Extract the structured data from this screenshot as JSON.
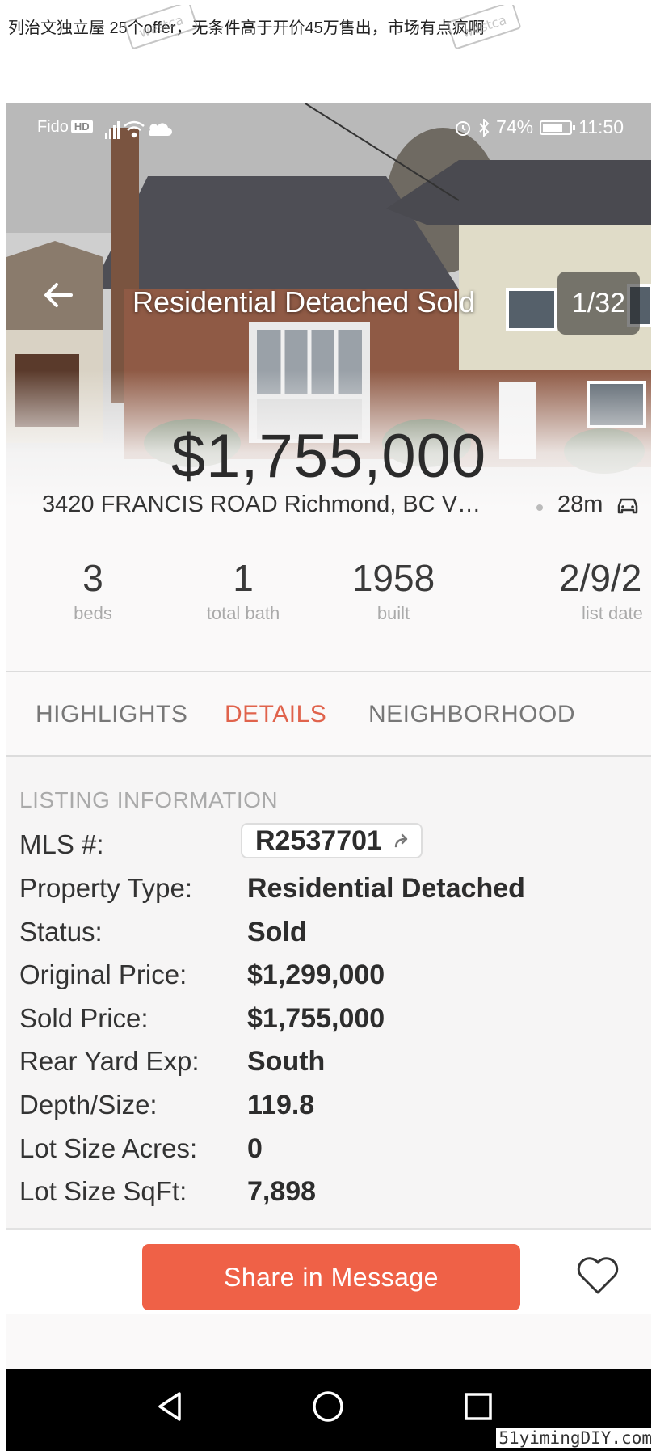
{
  "caption": "列治文独立屋 25个offer，无条件高于开价45万售出，市场有点疯啊",
  "status_bar": {
    "carrier": "Fido",
    "hd_badge": "HD",
    "battery": "74%",
    "battery_level": 0.74,
    "time": "11:50",
    "icons": [
      "signal-icon",
      "wifi-icon",
      "cloud-icon",
      "alarm-icon",
      "bluetooth-icon",
      "battery-icon"
    ]
  },
  "nav": {
    "back_icon": "back-arrow-icon",
    "title": "Residential Detached Sold",
    "photo_counter": "1/32"
  },
  "listing": {
    "price": "$1,755,000",
    "address": "3420 FRANCIS ROAD Richmond, BC V…",
    "drive_time": "28m",
    "drive_icon": "car-icon"
  },
  "stats": [
    {
      "value": "3",
      "label": "beds"
    },
    {
      "value": "1",
      "label": "total bath"
    },
    {
      "value": "1958",
      "label": "built"
    },
    {
      "value": "2/9/2",
      "label": "list date"
    }
  ],
  "tabs": [
    {
      "label": "HIGHLIGHTS",
      "active": false
    },
    {
      "label": "DETAILS",
      "active": true
    },
    {
      "label": "NEIGHBORHOOD",
      "active": false
    }
  ],
  "listing_info": {
    "section_title": "LISTING INFORMATION",
    "mls_label": "MLS #:",
    "mls_number": "R2537701",
    "rows": [
      {
        "key": "Property Type:",
        "value": "Residential Detached"
      },
      {
        "key": "Status:",
        "value": "Sold"
      },
      {
        "key": "Original Price:",
        "value": "$1,299,000"
      },
      {
        "key": "Sold Price:",
        "value": "$1,755,000"
      },
      {
        "key": "Rear Yard Exp:",
        "value": "South"
      },
      {
        "key": "Depth/Size:",
        "value": "119.8"
      },
      {
        "key": "Lot Size Acres:",
        "value": "0"
      },
      {
        "key": "Lot Size SqFt:",
        "value": "7,898"
      }
    ]
  },
  "actions": {
    "share_label": "Share in Message",
    "favorite_icon": "heart-icon"
  },
  "system_nav": [
    "back-triangle-icon",
    "home-circle-icon",
    "recents-square-icon"
  ],
  "colors": {
    "accent": "#ef6147",
    "active_tab": "#e0634c",
    "text": "#333333",
    "muted": "#aaaaaa"
  },
  "watermark": {
    "site": "westca.com",
    "corner": "51yimingDIY.com"
  }
}
